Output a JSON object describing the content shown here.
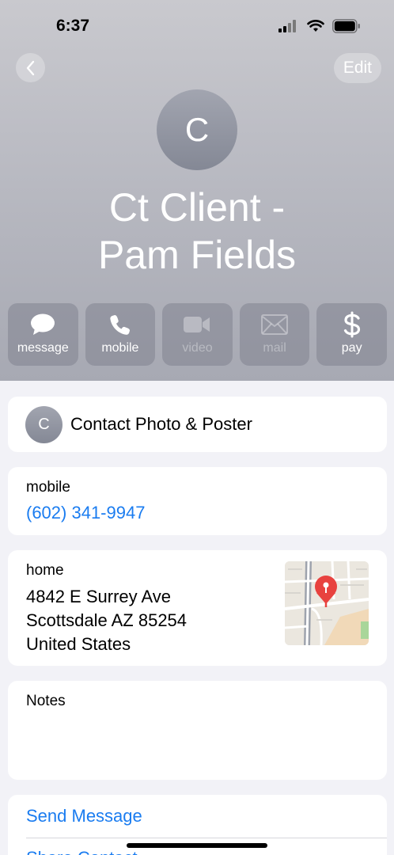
{
  "status_bar": {
    "time": "6:37"
  },
  "nav": {
    "edit_label": "Edit"
  },
  "contact": {
    "initial": "C",
    "name_line1": "Ct Client -",
    "name_line2": "Pam Fields"
  },
  "actions": [
    {
      "label": "message",
      "icon": "message-bubble-icon",
      "enabled": true
    },
    {
      "label": "mobile",
      "icon": "phone-icon",
      "enabled": true
    },
    {
      "label": "video",
      "icon": "video-camera-icon",
      "enabled": false
    },
    {
      "label": "mail",
      "icon": "envelope-icon",
      "enabled": false
    },
    {
      "label": "pay",
      "icon": "dollar-icon",
      "enabled": true
    }
  ],
  "photo_card": {
    "initial": "C",
    "label": "Contact Photo & Poster"
  },
  "phone_card": {
    "label": "mobile",
    "number": "(602) 341-9947"
  },
  "address_card": {
    "label": "home",
    "line1": "4842 E Surrey Ave",
    "line2": "Scottsdale AZ 85254",
    "line3": "United States"
  },
  "notes_card": {
    "label": "Notes"
  },
  "bottom_actions": {
    "send_message": "Send Message",
    "second_partial": "Share Contact"
  },
  "colors": {
    "link": "#1a7cf0",
    "pin": "#e8423f"
  }
}
